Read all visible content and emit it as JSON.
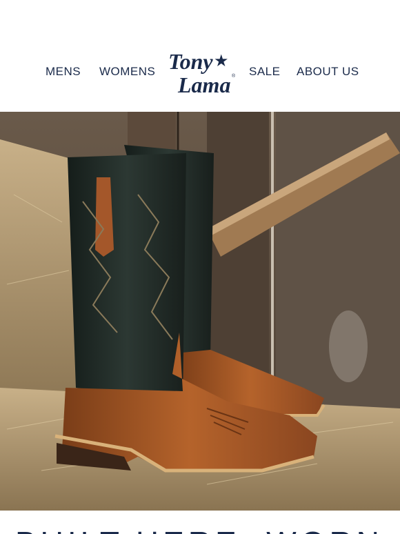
{
  "nav": {
    "mens": "MENS",
    "womens": "WOMENS",
    "sale": "SALE",
    "about": "ABOUT US"
  },
  "logo": {
    "line1": "Tony",
    "line2": "Lama",
    "star": "★",
    "mark": "®"
  },
  "hero": {
    "image": "cowboy-boots-on-hay-bale-photo"
  },
  "headline": {
    "text": "BUILT HERE. WORN"
  },
  "colors": {
    "brand_navy": "#1a2a4a",
    "leather_brown": "#9a4f22",
    "shaft_black": "#1f2a26",
    "hay": "#b59b70"
  }
}
